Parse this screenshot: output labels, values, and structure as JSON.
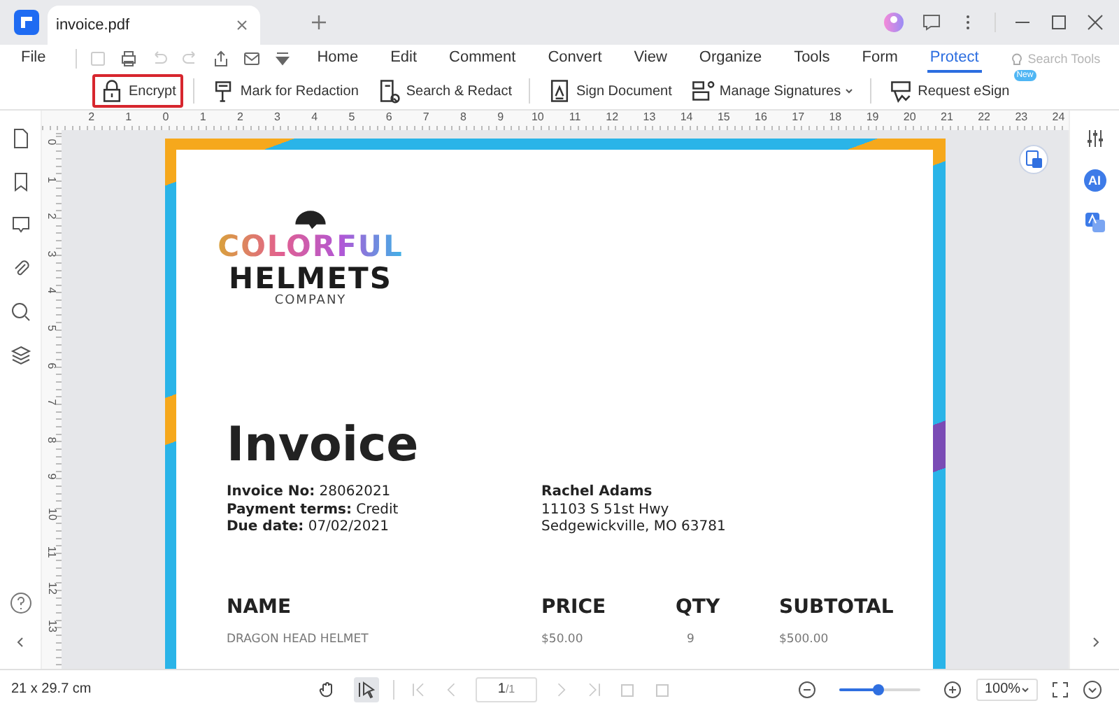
{
  "tab": {
    "title": "invoice.pdf"
  },
  "menu": {
    "file": "File",
    "items": [
      {
        "label": "Home",
        "selected": false
      },
      {
        "label": "Edit",
        "selected": false
      },
      {
        "label": "Comment",
        "selected": false
      },
      {
        "label": "Convert",
        "selected": false
      },
      {
        "label": "View",
        "selected": false
      },
      {
        "label": "Organize",
        "selected": false
      },
      {
        "label": "Tools",
        "selected": false
      },
      {
        "label": "Form",
        "selected": false
      },
      {
        "label": "Protect",
        "selected": true
      }
    ],
    "search": {
      "placeholder": "Search Tools"
    }
  },
  "toolbar": [
    {
      "kind": "lock",
      "label": "Encrypt",
      "highlighted": true,
      "dropdown": false,
      "separator_after": true
    },
    {
      "kind": "redact",
      "label": "Mark for Redaction",
      "highlighted": false,
      "dropdown": false,
      "separator_after": false
    },
    {
      "kind": "search-doc",
      "label": "Search & Redact",
      "highlighted": false,
      "dropdown": false,
      "separator_after": true
    },
    {
      "kind": "sign-doc",
      "label": "Sign Document",
      "highlighted": false,
      "dropdown": false,
      "separator_after": false
    },
    {
      "kind": "signatures",
      "label": "Manage Signatures",
      "highlighted": false,
      "dropdown": true,
      "separator_after": true
    },
    {
      "kind": "esign",
      "label": "Request eSign",
      "highlighted": false,
      "dropdown": false,
      "badge": "New",
      "separator_after": false
    }
  ],
  "rulers": {
    "horizontal": [
      "2",
      "1",
      "0",
      "1",
      "2",
      "3",
      "4",
      "5",
      "6",
      "7",
      "8",
      "9",
      "10",
      "11",
      "12",
      "13",
      "14",
      "15",
      "16",
      "17",
      "18",
      "19",
      "20",
      "21",
      "22",
      "23",
      "24"
    ],
    "vertical": [
      "0",
      "1",
      "2",
      "3",
      "4",
      "5",
      "6",
      "7",
      "8",
      "9",
      "10",
      "11",
      "12",
      "13"
    ]
  },
  "document": {
    "logo": {
      "brand": "COLORFUL",
      "name": "HELMETS",
      "sub": "COMPANY"
    },
    "title": "Invoice",
    "details": [
      "**Invoice No:** 28062021",
      "**Payment terms:** Credit",
      "**Due date:** 07/02/2021"
    ],
    "recipient": {
      "name": "Rachel Adams",
      "lines": [
        "11103 S 51st Hwy",
        "Sedgewickville, MO 63781"
      ]
    },
    "table": {
      "columns": [
        "NAME",
        "PRICE",
        "QTY",
        "SUBTOTAL"
      ],
      "rows": [
        [
          "DRAGON HEAD HELMET",
          "$50.00",
          "9",
          "$500.00"
        ]
      ]
    }
  },
  "right_panel": {
    "ai_label": "AI"
  },
  "status": {
    "page_size": "21 x 29.7 cm",
    "tools": [
      {
        "kind": "hand",
        "selected": false
      },
      {
        "kind": "select",
        "selected": true
      }
    ],
    "nav": [
      {
        "kind": "first",
        "disabled": true
      },
      {
        "kind": "prev",
        "disabled": true
      }
    ],
    "page": "1",
    "page_total": "/1",
    "nav_after": [
      {
        "kind": "next",
        "disabled": true
      },
      {
        "kind": "last",
        "disabled": true
      }
    ],
    "zoom": {
      "level": 0.48
    },
    "zoom_value": "100%"
  }
}
